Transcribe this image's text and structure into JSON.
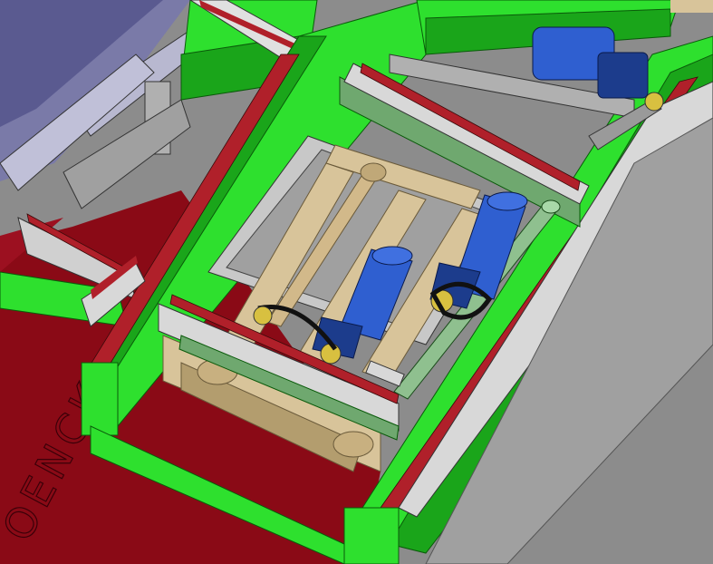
{
  "scene": {
    "floor_marking_text": "OENCK",
    "colors": {
      "background": "#8c8c8c",
      "floor_red": "#8a0a16",
      "frame_green": "#2ee02e",
      "frame_green_dark": "#1aa51a",
      "rail_grey": "#c8c8c8",
      "wood": "#d8c49a",
      "wood_dark": "#b39d6e",
      "motor_blue": "#2f5fd0",
      "motor_blue_dark": "#1c3c8c",
      "chain_red": "#b0202a",
      "transfer_green": "#6fa86f",
      "roller_green": "#8fc08f",
      "machine_purple": "#7a7aa8"
    }
  }
}
